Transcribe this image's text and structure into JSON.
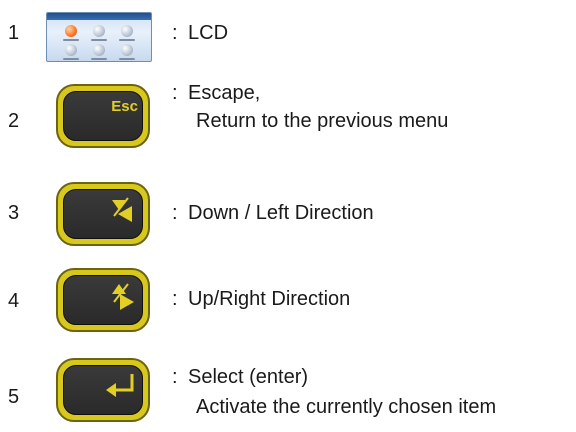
{
  "rows": [
    {
      "number": "1",
      "icon": "lcd-screen-icon",
      "lines": [
        "LCD"
      ]
    },
    {
      "number": "2",
      "icon": "esc-key-icon",
      "key_label": "Esc",
      "lines": [
        "Escape,",
        "Return to the previous menu"
      ]
    },
    {
      "number": "3",
      "icon": "down-left-key-icon",
      "lines": [
        "Down / Left Direction"
      ]
    },
    {
      "number": "4",
      "icon": "up-right-key-icon",
      "lines": [
        "Up/Right Direction"
      ]
    },
    {
      "number": "5",
      "icon": "enter-key-icon",
      "lines": [
        "Select (enter)",
        "Activate the currently chosen item"
      ]
    }
  ],
  "colon": ":",
  "colors": {
    "key_bezel": "#d8c71c",
    "key_face": "#2f2f2f",
    "key_glyph": "#e3cf24",
    "lcd_titlebar": "#1f4f8c"
  }
}
